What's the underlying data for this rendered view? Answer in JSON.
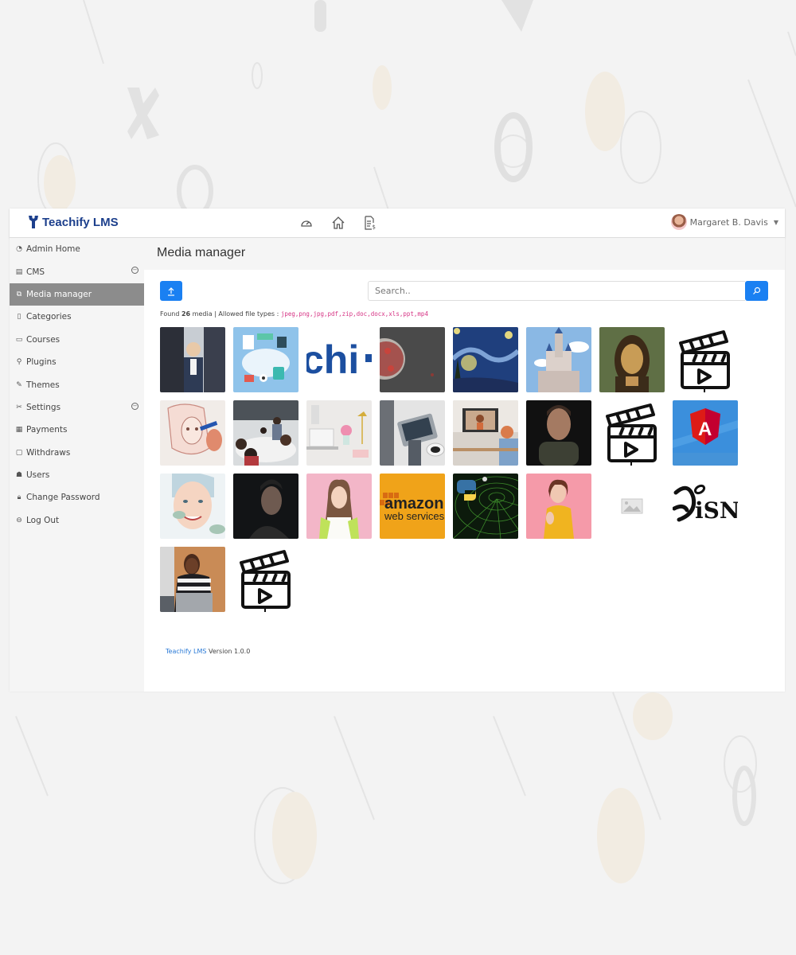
{
  "app": {
    "brand": "Teachify LMS",
    "brand_color": "#1c3f8c",
    "accent_color": "#1a80f2"
  },
  "topbar": {
    "icons": [
      "dashboard-icon",
      "home-icon",
      "invoice-icon"
    ],
    "user_name": "Margaret B. Davis"
  },
  "sidebar": {
    "items": [
      {
        "label": "Admin Home",
        "icon": "dashboard-icon",
        "expandable": false,
        "active": false
      },
      {
        "label": "CMS",
        "icon": "cms-icon",
        "expandable": true,
        "active": false
      },
      {
        "label": "Media manager",
        "icon": "media-icon",
        "expandable": false,
        "active": true
      },
      {
        "label": "Categories",
        "icon": "categories-icon",
        "expandable": false,
        "active": false
      },
      {
        "label": "Courses",
        "icon": "courses-icon",
        "expandable": false,
        "active": false
      },
      {
        "label": "Plugins",
        "icon": "plugin-icon",
        "expandable": false,
        "active": false
      },
      {
        "label": "Themes",
        "icon": "brush-icon",
        "expandable": false,
        "active": false
      },
      {
        "label": "Settings",
        "icon": "settings-icon",
        "expandable": true,
        "active": false
      },
      {
        "label": "Payments",
        "icon": "payments-icon",
        "expandable": false,
        "active": false
      },
      {
        "label": "Withdraws",
        "icon": "wallet-icon",
        "expandable": false,
        "active": false
      },
      {
        "label": "Users",
        "icon": "users-icon",
        "expandable": false,
        "active": false
      },
      {
        "label": "Change Password",
        "icon": "lock-icon",
        "expandable": false,
        "active": false
      },
      {
        "label": "Log Out",
        "icon": "logout-icon",
        "expandable": false,
        "active": false
      }
    ]
  },
  "main": {
    "title": "Media manager",
    "search_placeholder": "Search..",
    "found_prefix": "Found",
    "found_count": "26",
    "found_suffix": "media | Allowed file types :",
    "allowed_types": "jpeg,png,jpg,pdf,zip,doc,docx,xls,ppt,mp4",
    "media": [
      {
        "kind": "photo",
        "desc": "business meeting"
      },
      {
        "kind": "illustration",
        "desc": "cloud apps"
      },
      {
        "kind": "logo-text",
        "desc": "chi",
        "text": "chi"
      },
      {
        "kind": "photo",
        "desc": "virus"
      },
      {
        "kind": "painting",
        "desc": "starry night"
      },
      {
        "kind": "photo",
        "desc": "castle"
      },
      {
        "kind": "painting",
        "desc": "mona lisa"
      },
      {
        "kind": "video",
        "desc": "video clapperboard"
      },
      {
        "kind": "illustration",
        "desc": "girl sketch"
      },
      {
        "kind": "photo",
        "desc": "team meeting"
      },
      {
        "kind": "photo",
        "desc": "desk with flowers"
      },
      {
        "kind": "photo",
        "desc": "tablet"
      },
      {
        "kind": "photo",
        "desc": "video call"
      },
      {
        "kind": "photo",
        "desc": "man portrait"
      },
      {
        "kind": "video",
        "desc": "video clapperboard"
      },
      {
        "kind": "logo",
        "desc": "angular",
        "text": "A"
      },
      {
        "kind": "photo",
        "desc": "woman skincare"
      },
      {
        "kind": "photo",
        "desc": "man dark portrait"
      },
      {
        "kind": "photo",
        "desc": "woman pink background"
      },
      {
        "kind": "logo",
        "desc": "amazon web services",
        "text": "amazon",
        "subtext": "web services"
      },
      {
        "kind": "logo",
        "desc": "python"
      },
      {
        "kind": "photo",
        "desc": "woman yellow shirt"
      },
      {
        "kind": "placeholder",
        "desc": "image placeholder"
      },
      {
        "kind": "logo-text",
        "desc": "disney",
        "text": "Disni"
      },
      {
        "kind": "photo",
        "desc": "woman laptop"
      },
      {
        "kind": "video",
        "desc": "video clapperboard"
      }
    ]
  },
  "footer": {
    "link": "Teachify LMS",
    "version": "Version 1.0.0"
  }
}
